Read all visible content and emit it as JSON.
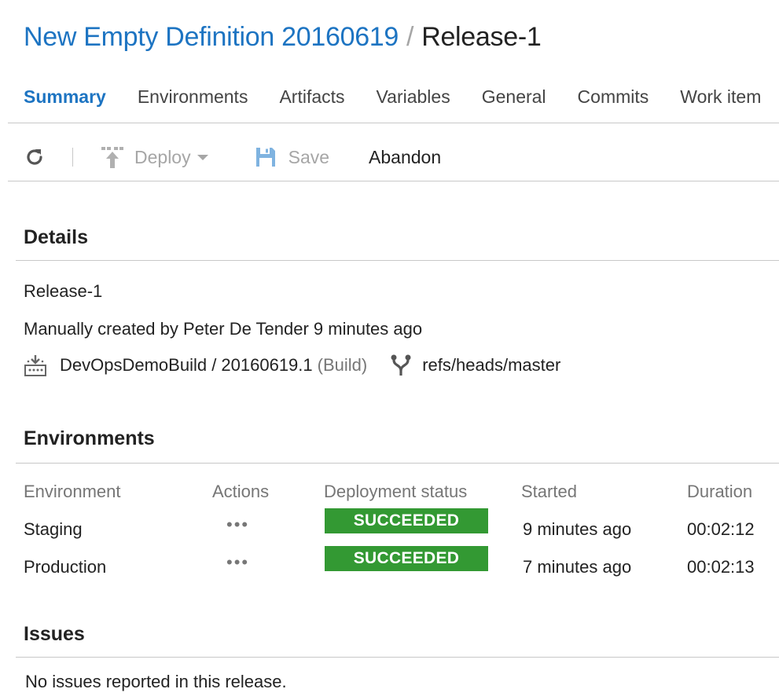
{
  "breadcrumb": {
    "definition": "New Empty Definition 20160619",
    "separator": "/",
    "release": "Release-1"
  },
  "tabs": [
    {
      "label": "Summary",
      "active": true
    },
    {
      "label": "Environments",
      "active": false
    },
    {
      "label": "Artifacts",
      "active": false
    },
    {
      "label": "Variables",
      "active": false
    },
    {
      "label": "General",
      "active": false
    },
    {
      "label": "Commits",
      "active": false
    },
    {
      "label": "Work item",
      "active": false
    }
  ],
  "toolbar": {
    "refresh_icon": "refresh-icon",
    "deploy_label": "Deploy",
    "save_label": "Save",
    "abandon_label": "Abandon"
  },
  "details": {
    "title": "Details",
    "release_name": "Release-1",
    "created_by": "Manually created by Peter De Tender 9 minutes ago",
    "build": "DevOpsDemoBuild / 20160619.1",
    "build_type": "(Build)",
    "branch": "refs/heads/master"
  },
  "environments": {
    "title": "Environments",
    "headers": [
      "Environment",
      "Actions",
      "Deployment status",
      "Started",
      "Duration"
    ],
    "actions_glyph": "•••",
    "rows": [
      {
        "name": "Staging",
        "status": "SUCCEEDED",
        "started": "9 minutes ago",
        "duration": "00:02:12"
      },
      {
        "name": "Production",
        "status": "SUCCEEDED",
        "started": "7 minutes ago",
        "duration": "00:02:13"
      }
    ]
  },
  "issues": {
    "title": "Issues",
    "message": "No issues reported in this release."
  },
  "colors": {
    "link_blue": "#1d74c2",
    "success_green": "#339933",
    "muted_gray": "#767676"
  }
}
